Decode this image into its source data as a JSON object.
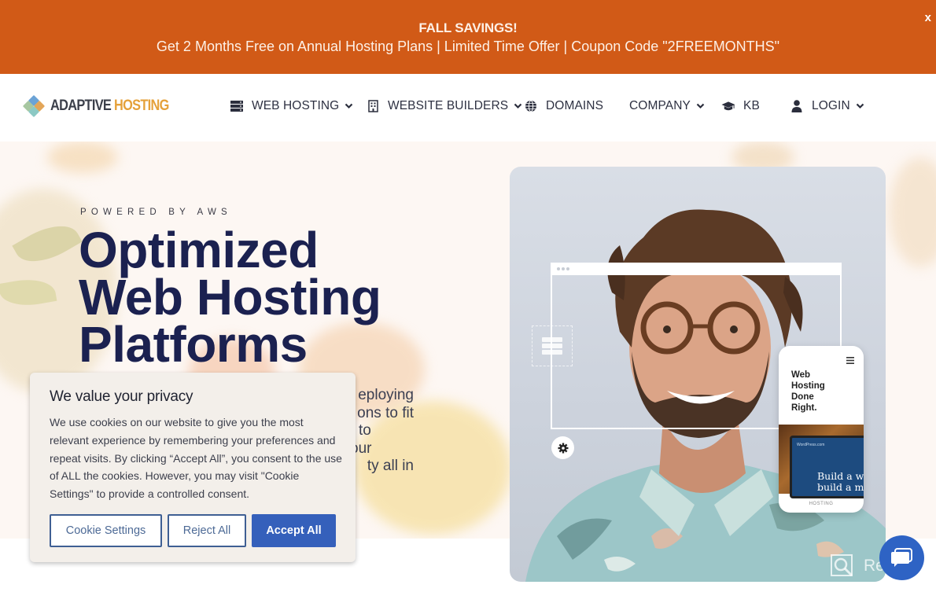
{
  "promo": {
    "title": "FALL SAVINGS!",
    "message": "Get 2 Months Free on Annual Hosting Plans | Limited Time Offer | Coupon Code \"2FREEMONTHS\"",
    "close_label": "x",
    "background_color": "#d15a17"
  },
  "header": {
    "logo": {
      "part1": "ADAPTIVE",
      "part2": "HOSTING"
    },
    "nav": [
      {
        "label": "WEB HOSTING",
        "icon": "server-icon",
        "has_dropdown": true
      },
      {
        "label": "WEBSITE BUILDERS",
        "icon": "building-icon",
        "has_dropdown": true
      },
      {
        "label": "DOMAINS",
        "icon": "globe-icon",
        "has_dropdown": false
      },
      {
        "label": "COMPANY",
        "icon": null,
        "has_dropdown": true
      },
      {
        "label": "KB",
        "icon": "graduation-cap-icon",
        "has_dropdown": false
      },
      {
        "label": "LOGIN",
        "icon": "user-icon",
        "has_dropdown": true
      }
    ]
  },
  "hero": {
    "eyebrow": "POWERED BY AWS",
    "headline": [
      "Optimized",
      "Web Hosting",
      "Platforms"
    ],
    "description_visible": [
      "eploying",
      "ons to fit",
      "to",
      "our",
      "ty all in"
    ],
    "image_card": {
      "phone_title": [
        "Web",
        "Hosting",
        "Done",
        "Right."
      ],
      "phone_screen_brand": "WordPress.com",
      "phone_screen_text": [
        "Build a we",
        "build a mo"
      ],
      "phone_footer": "HOSTING"
    }
  },
  "cookie_banner": {
    "title": "We value your privacy",
    "body": "We use cookies on our website to give you the most relevant experience by remembering your preferences and repeat visits. By clicking “Accept All”, you consent to the use of ALL the cookies. However, you may visit \"Cookie Settings\" to provide a controlled consent.",
    "buttons": {
      "settings": "Cookie Settings",
      "reject": "Reject All",
      "accept": "Accept All"
    },
    "accent_color": "#3560bb"
  },
  "watermark": {
    "label": "Revain"
  },
  "chat_widget": {
    "icon": "chat-bubble-icon",
    "color": "#2e63c4"
  }
}
